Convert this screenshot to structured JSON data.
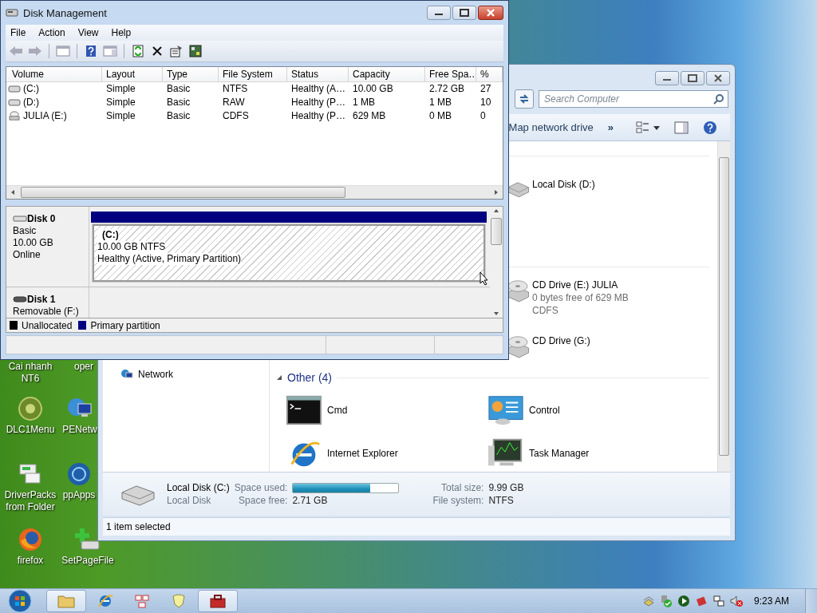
{
  "disk_management": {
    "window": {
      "title": "Disk Management"
    },
    "menu": [
      "File",
      "Action",
      "View",
      "Help"
    ],
    "volume_table": {
      "columns": [
        "Volume",
        "Layout",
        "Type",
        "File System",
        "Status",
        "Capacity",
        "Free Spa…",
        "%"
      ],
      "rows": [
        {
          "kind": "disk",
          "cells": [
            "(C:)",
            "Simple",
            "Basic",
            "NTFS",
            "Healthy (A…",
            "10.00 GB",
            "2.72 GB",
            "27"
          ]
        },
        {
          "kind": "disk",
          "cells": [
            "(D:)",
            "Simple",
            "Basic",
            "RAW",
            "Healthy (P…",
            "1 MB",
            "1 MB",
            "10"
          ]
        },
        {
          "kind": "cd",
          "cells": [
            "JULIA (E:)",
            "Simple",
            "Basic",
            "CDFS",
            "Healthy (P…",
            "629 MB",
            "0 MB",
            "0"
          ]
        }
      ]
    },
    "disks": [
      {
        "name": "Disk 0",
        "kind": "hdd",
        "lines": [
          "Basic",
          "10.00 GB",
          "Online"
        ]
      },
      {
        "name": "Disk 1",
        "kind": "removable",
        "lines": [
          "Removable (F:)"
        ]
      }
    ],
    "partition": {
      "label": "(C:)",
      "size": "10.00 GB NTFS",
      "status": "Healthy (Active, Primary Partition)",
      "selected": true
    },
    "legend": [
      {
        "label": "Unallocated",
        "color": "#000000"
      },
      {
        "label": "Primary partition",
        "color": "#000080"
      }
    ]
  },
  "explorer": {
    "search": {
      "placeholder": "Search Computer"
    },
    "toolbar": {
      "map_drive": "Map network drive",
      "more": "»"
    },
    "drives": [
      {
        "name": "Local Disk (D:)",
        "kind": "hdd"
      },
      {
        "name": "CD Drive (E:) JULIA",
        "kind": "cd",
        "lines": [
          "0 bytes free of 629 MB",
          "CDFS"
        ]
      },
      {
        "name": "CD Drive (G:)",
        "kind": "cd"
      }
    ],
    "nav": [
      {
        "label": "Network",
        "kind": "network"
      }
    ],
    "other_group": {
      "title": "Other (4)",
      "expanded": true,
      "items": [
        {
          "name": "Cmd",
          "kind": "cmd"
        },
        {
          "name": "Control",
          "kind": "control"
        },
        {
          "name": "Internet Explorer",
          "kind": "ie"
        },
        {
          "name": "Task Manager",
          "kind": "taskmgr"
        }
      ]
    },
    "details": {
      "name": "Local Disk (C:)",
      "type": "Local Disk",
      "used_label": "Space used:",
      "level": 0.73,
      "free_label": "Space free:",
      "free": "2.71 GB",
      "total_label": "Total size:",
      "total": "9.99 GB",
      "fs_label": "File system:",
      "fs": "NTFS"
    },
    "status_bar": "1 item selected"
  },
  "desktop_icons": [
    {
      "label": "Cai nhanh NT6",
      "kind": "none"
    },
    {
      "label": "oper",
      "kind": "none"
    },
    {
      "label": "DLC1Menu",
      "kind": "disc"
    },
    {
      "label": "PENetw",
      "kind": "network"
    },
    {
      "label": "DriverPacks from Folder",
      "kind": "driver"
    },
    {
      "label": "ppApps",
      "kind": "globe"
    },
    {
      "label": "firefox",
      "kind": "firefox"
    },
    {
      "label": "SetPageFile",
      "kind": "pagefile"
    }
  ],
  "taskbar": {
    "items": [
      {
        "kind": "folder",
        "selected": true
      },
      {
        "kind": "ie",
        "selected": false
      },
      {
        "kind": "network",
        "selected": false
      },
      {
        "kind": "shield",
        "selected": false
      },
      {
        "kind": "toolbox",
        "selected": true
      }
    ],
    "clock": "9:23 AM"
  }
}
